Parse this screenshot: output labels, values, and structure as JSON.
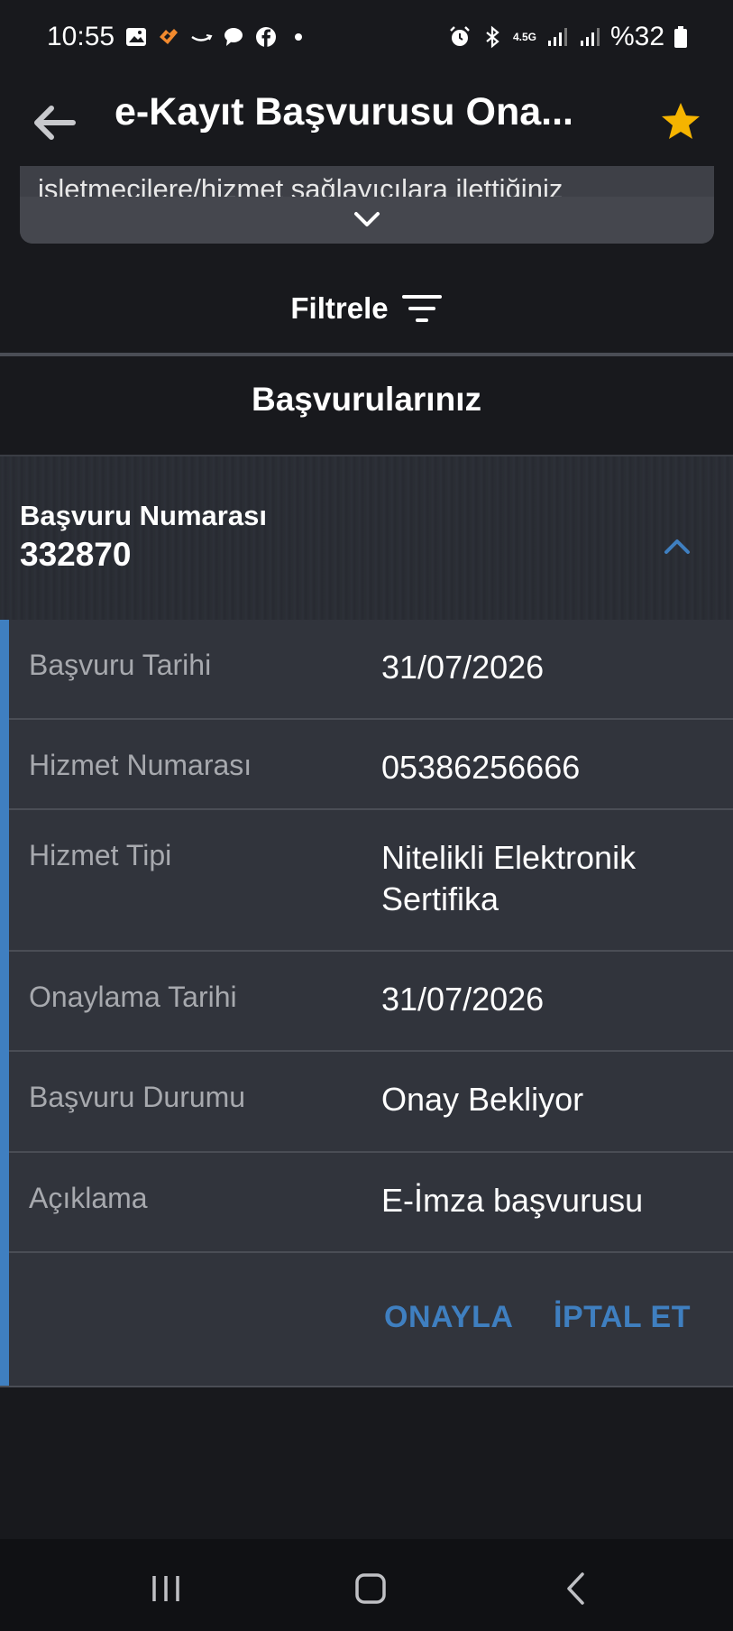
{
  "status_bar": {
    "time": "10:55",
    "network": "4.5G",
    "battery": "%32",
    "left_icons": [
      "gallery-icon",
      "app-icon",
      "amazon-icon",
      "chat-icon",
      "facebook-icon",
      "dot-icon"
    ],
    "right_icons": [
      "alarm-icon",
      "bluetooth-icon",
      "signal-icon",
      "signal-icon",
      "battery-icon"
    ]
  },
  "app_bar": {
    "title": "e-Kayıt Başvurusu Ona...",
    "back_icon": "arrow-left-icon",
    "favorite_icon": "star-icon",
    "favorite_color": "#f5b400"
  },
  "info_card": {
    "text": "işletmecilere/hizmet sağlayıcılara ilettiğiniz",
    "toggle_icon": "chevron-down-icon"
  },
  "filter": {
    "label": "Filtrele",
    "icon": "filter-icon"
  },
  "section": {
    "title": "Başvurularınız"
  },
  "application": {
    "number_label": "Başvuru Numarası",
    "number_value": "332870",
    "collapse_icon": "chevron-up-icon",
    "details": [
      {
        "label": "Başvuru Tarihi",
        "value": "31/07/2026"
      },
      {
        "label": "Hizmet Numarası",
        "value": "05386256666"
      },
      {
        "label": "Hizmet Tipi",
        "value": "Nitelikli Elektronik Sertifika"
      },
      {
        "label": "Onaylama Tarihi",
        "value": "31/07/2026"
      },
      {
        "label": "Başvuru Durumu",
        "value": "Onay Bekliyor"
      },
      {
        "label": "Açıklama",
        "value": "E-İmza başvurusu"
      }
    ],
    "actions": {
      "approve": "ONAYLA",
      "cancel": "İPTAL ET"
    },
    "accent_color": "#3f7fc0"
  },
  "nav_bar": {
    "recents_icon": "recents-icon",
    "home_icon": "home-icon",
    "back_icon": "back-icon"
  }
}
